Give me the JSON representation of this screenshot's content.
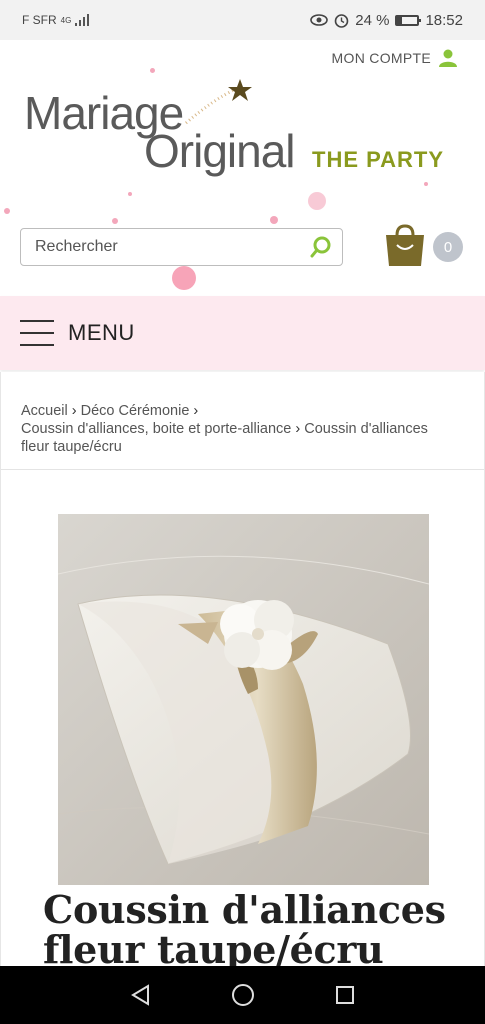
{
  "status": {
    "carrier": "F SFR",
    "network": "4G",
    "battery_text": "24 %",
    "battery_level": 0.24,
    "time": "18:52"
  },
  "header": {
    "account_label": "MON COMPTE",
    "logo_word1": "Mariage",
    "logo_word2": "Original",
    "logo_suffix": "THE PARTY",
    "search_placeholder": "Rechercher",
    "cart_count": "0",
    "accent_color": "#8a9a1e",
    "cart_color": "#7a6a2a"
  },
  "menu": {
    "label": "MENU"
  },
  "breadcrumb": {
    "items": [
      "Accueil",
      "Déco Cérémonie",
      "Coussin d'alliances, boite et porte-alliance",
      "Coussin d'alliances fleur taupe/écru"
    ]
  },
  "product": {
    "title": "Coussin d'alliances fleur taupe/écru"
  },
  "icons": [
    "user-icon",
    "search-icon",
    "cart-icon",
    "menu-icon",
    "back-icon",
    "home-icon",
    "recents-icon"
  ]
}
